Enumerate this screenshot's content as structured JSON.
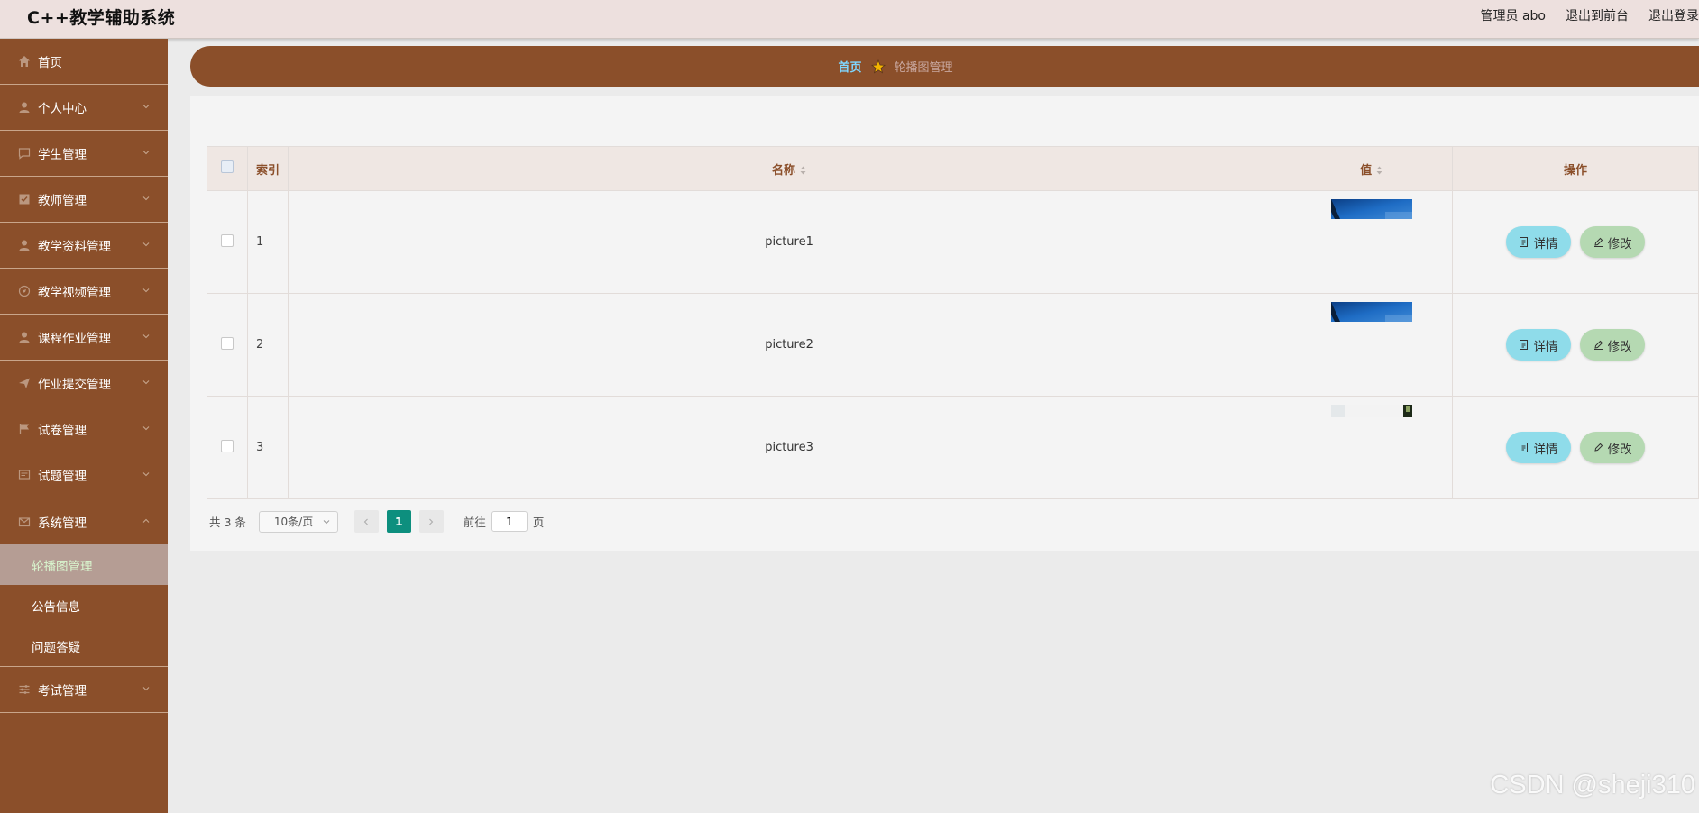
{
  "app": {
    "title": "C++教学辅助系统",
    "user_label": "管理员 abo",
    "to_front_label": "退出到前台",
    "logout_label": "退出登录"
  },
  "sidebar": {
    "items": [
      {
        "label": "首页",
        "icon": "home-icon"
      },
      {
        "label": "个人中心",
        "icon": "user-icon"
      },
      {
        "label": "学生管理",
        "icon": "chat-icon"
      },
      {
        "label": "教师管理",
        "icon": "checkbox-icon"
      },
      {
        "label": "教学资料管理",
        "icon": "user-icon"
      },
      {
        "label": "教学视频管理",
        "icon": "compass-icon"
      },
      {
        "label": "课程作业管理",
        "icon": "user-icon"
      },
      {
        "label": "作业提交管理",
        "icon": "send-icon"
      },
      {
        "label": "试卷管理",
        "icon": "flag-icon"
      },
      {
        "label": "试题管理",
        "icon": "message-icon"
      },
      {
        "label": "系统管理",
        "icon": "mail-icon"
      }
    ],
    "system_sub": [
      {
        "label": "轮播图管理",
        "active": true
      },
      {
        "label": "公告信息",
        "active": false
      },
      {
        "label": "问题答疑",
        "active": false
      }
    ],
    "last_item": {
      "label": "考试管理",
      "icon": "sliders-icon"
    }
  },
  "breadcrumb": {
    "home": "首页",
    "current": "轮播图管理"
  },
  "table": {
    "headers": {
      "index": "索引",
      "name": "名称",
      "value": "值",
      "ops": "操作"
    },
    "rows": [
      {
        "index": "1",
        "name": "picture1",
        "thumb": "blue-sky"
      },
      {
        "index": "2",
        "name": "picture2",
        "thumb": "blue-sky"
      },
      {
        "index": "3",
        "name": "picture3",
        "thumb": "light"
      }
    ],
    "detail_label": "详情",
    "edit_label": "修改"
  },
  "pagination": {
    "total": "共 3 条",
    "page_size": "10条/页",
    "current_page": "1",
    "goto_label": "前往",
    "goto_value": "1",
    "page_suffix": "页"
  },
  "watermark": "CSDN @sheji310",
  "colors": {
    "sidebar": "#8b4f2a",
    "accent": "#0d8f7e",
    "detail_button": "#8fdcea",
    "edit_button": "#b5d9b2"
  }
}
